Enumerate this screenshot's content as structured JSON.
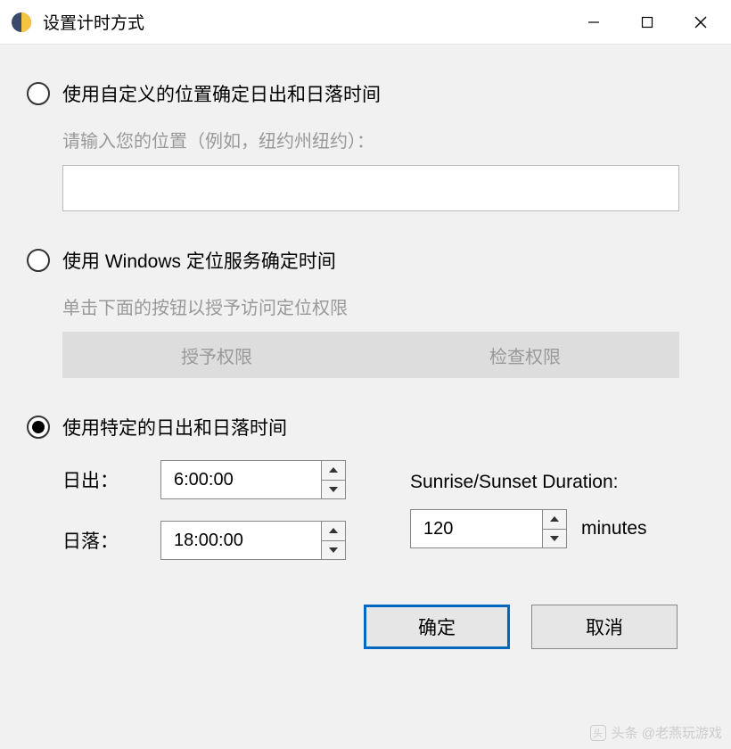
{
  "window": {
    "title": "设置计时方式"
  },
  "option_custom": {
    "label": "使用自定义的位置确定日出和日落时间",
    "hint": "请输入您的位置（例如，纽约州纽约）：",
    "input_value": ""
  },
  "option_windows": {
    "label": "使用 Windows 定位服务确定时间",
    "hint": "单击下面的按钮以授予访问定位权限",
    "grant_btn": "授予权限",
    "check_btn": "检查权限"
  },
  "option_specific": {
    "label": "使用特定的日出和日落时间",
    "sunrise_label": "日出：",
    "sunset_label": "日落：",
    "sunrise_value": "6:00:00",
    "sunset_value": "18:00:00",
    "duration_label": "Sunrise/Sunset Duration:",
    "duration_value": "120",
    "duration_unit": "minutes"
  },
  "footer": {
    "ok": "确定",
    "cancel": "取消"
  },
  "watermark": "头条 @老燕玩游戏"
}
